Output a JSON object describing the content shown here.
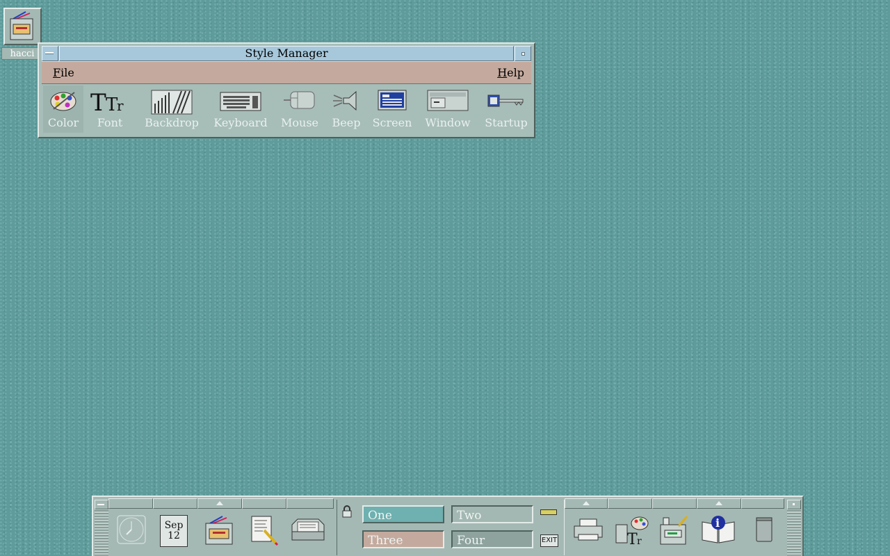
{
  "desktop": {
    "icon_label": "hacci"
  },
  "style_manager": {
    "title": "Style Manager",
    "menu": {
      "file": "File",
      "file_mnemonic": "F",
      "file_rest": "ile",
      "help": "Help",
      "help_mnemonic": "H",
      "help_rest": "elp"
    },
    "tools": [
      {
        "label": "Color",
        "icon": "palette-icon"
      },
      {
        "label": "Font",
        "icon": "font-icon"
      },
      {
        "label": "Backdrop",
        "icon": "backdrop-icon"
      },
      {
        "label": "Keyboard",
        "icon": "keyboard-icon"
      },
      {
        "label": "Mouse",
        "icon": "mouse-icon"
      },
      {
        "label": "Beep",
        "icon": "speaker-icon"
      },
      {
        "label": "Screen",
        "icon": "screen-icon"
      },
      {
        "label": "Window",
        "icon": "window-icon"
      },
      {
        "label": "Startup",
        "icon": "key-icon"
      }
    ]
  },
  "front_panel": {
    "date": {
      "month": "Sep",
      "day": "12"
    },
    "workspaces": [
      "One",
      "Two",
      "Three",
      "Four"
    ],
    "active_workspace": "Three",
    "exit_label": "EXIT",
    "colors": {
      "ws_one": "#6fb0b0",
      "ws_two": "#a3b8b2",
      "ws_three": "#c4aa9e",
      "ws_four": "#8ea39e"
    }
  }
}
